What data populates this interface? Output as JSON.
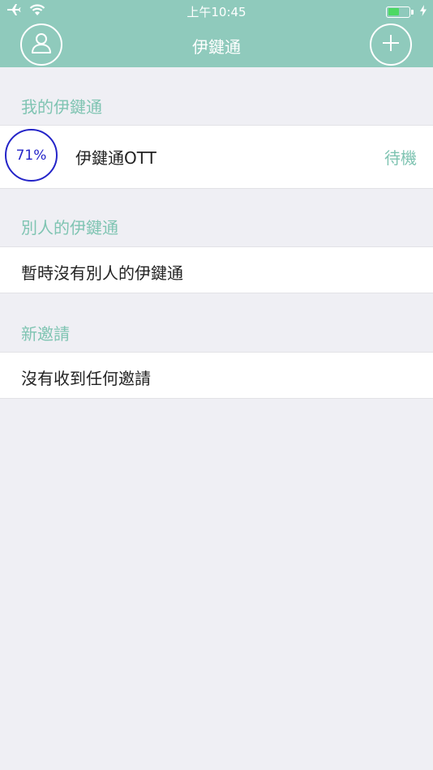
{
  "status_bar": {
    "time": "上午10:45",
    "icons": [
      "airplane-icon",
      "wifi-icon",
      "battery-icon",
      "charging-icon"
    ],
    "battery_level": 0.55
  },
  "nav": {
    "title": "伊鍵通",
    "left_icon": "profile-icon",
    "right_icon": "add-icon"
  },
  "sections": {
    "mine": {
      "header": "我的伊鍵通",
      "device": {
        "percent": "71%",
        "name": "伊鍵通OTT",
        "status": "待機"
      }
    },
    "others": {
      "header": "別人的伊鍵通",
      "empty_text": "暫時沒有別人的伊鍵通"
    },
    "invites": {
      "header": "新邀請",
      "empty_text": "沒有收到任何邀請"
    }
  },
  "colors": {
    "header_bg": "#8fcabc",
    "section_text": "#7fc4b2",
    "ring": "#2424c8",
    "page_bg": "#efeff4"
  }
}
